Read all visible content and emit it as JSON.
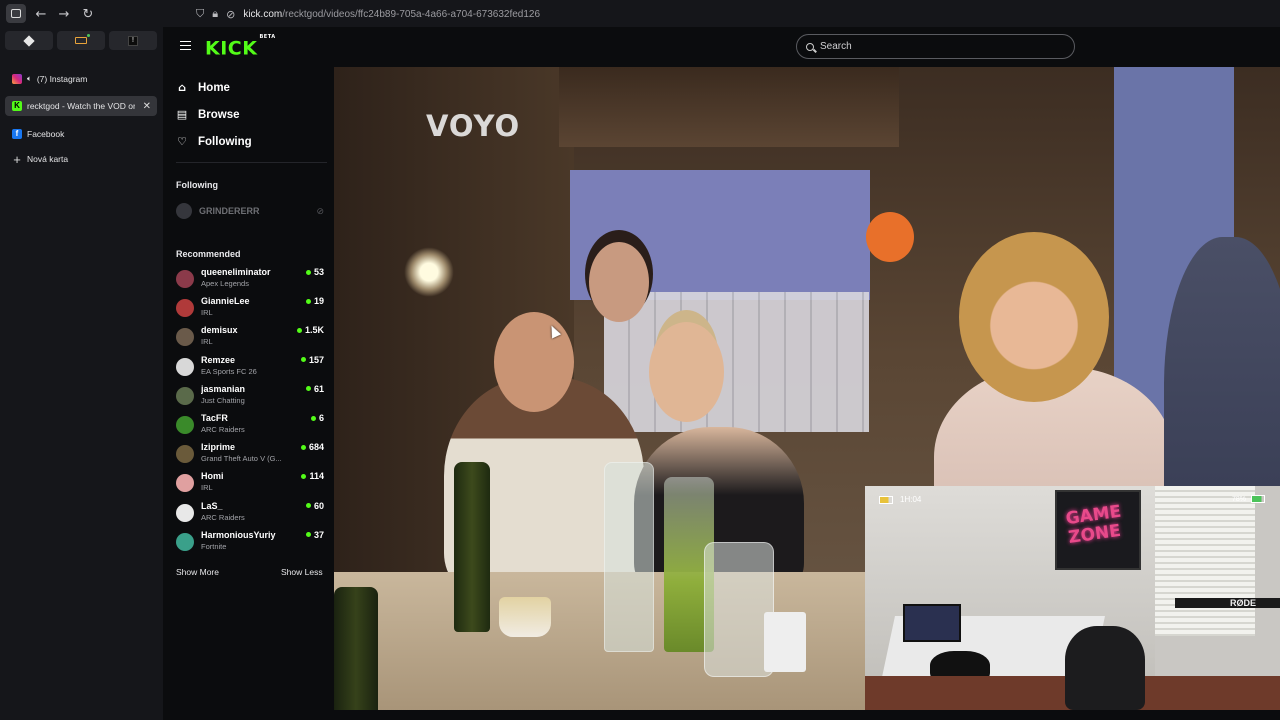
{
  "browser": {
    "url_domain": "kick.com",
    "url_path": "/recktgod/videos/ffc24b89-705a-4a66-a704-673632fed126",
    "tabs": [
      {
        "label": "(7) Instagram",
        "favicon": "instagram-icon",
        "active": false
      },
      {
        "label": "recktgod - Watch the VOD on K",
        "favicon": "kick-icon",
        "active": true
      },
      {
        "label": "Facebook",
        "favicon": "facebook-icon",
        "active": false
      },
      {
        "label": "Nová karta",
        "favicon": "plus-icon",
        "active": false
      }
    ]
  },
  "header": {
    "logo": "KICK",
    "logo_badge": "BETA",
    "search_placeholder": "Search"
  },
  "sidebar": {
    "nav": [
      {
        "label": "Home",
        "icon": "home-icon"
      },
      {
        "label": "Browse",
        "icon": "browse-icon"
      },
      {
        "label": "Following",
        "icon": "heart-icon"
      }
    ],
    "following_title": "Following",
    "following": [
      {
        "name": "GRINDERERR",
        "status": "offline"
      }
    ],
    "recommended_title": "Recommended",
    "recommended": [
      {
        "name": "queeneliminator",
        "category": "Apex Legends",
        "viewers": "53",
        "color": "#8b3a4a"
      },
      {
        "name": "GiannieLee",
        "category": "IRL",
        "viewers": "19",
        "color": "#b03a3a"
      },
      {
        "name": "demisux",
        "category": "IRL",
        "viewers": "1.5K",
        "color": "#6a5a4a"
      },
      {
        "name": "Remzee",
        "category": "EA Sports FC 26",
        "viewers": "157",
        "color": "#d8d8d8"
      },
      {
        "name": "jasmanian",
        "category": "Just Chatting",
        "viewers": "61",
        "color": "#5a6a4a"
      },
      {
        "name": "TacFR",
        "category": "ARC Raiders",
        "viewers": "6",
        "color": "#3a8a2a"
      },
      {
        "name": "Iziprime",
        "category": "Grand Theft Auto V (G...",
        "viewers": "684",
        "color": "#6a5a3a"
      },
      {
        "name": "Homi",
        "category": "IRL",
        "viewers": "114",
        "color": "#e0a0a0"
      },
      {
        "name": "LaS_",
        "category": "ARC Raiders",
        "viewers": "60",
        "color": "#e8e8e8"
      },
      {
        "name": "HarmoniousYuriy",
        "category": "Fortnite",
        "viewers": "37",
        "color": "#3aa08a"
      }
    ],
    "show_more": "Show More",
    "show_less": "Show Less"
  },
  "video": {
    "watermark": "VOYO",
    "cam_timer": "1H:04",
    "cam_battery": "78%",
    "poster_text": "GAME ZONE",
    "mic_brand": "RØDE"
  }
}
